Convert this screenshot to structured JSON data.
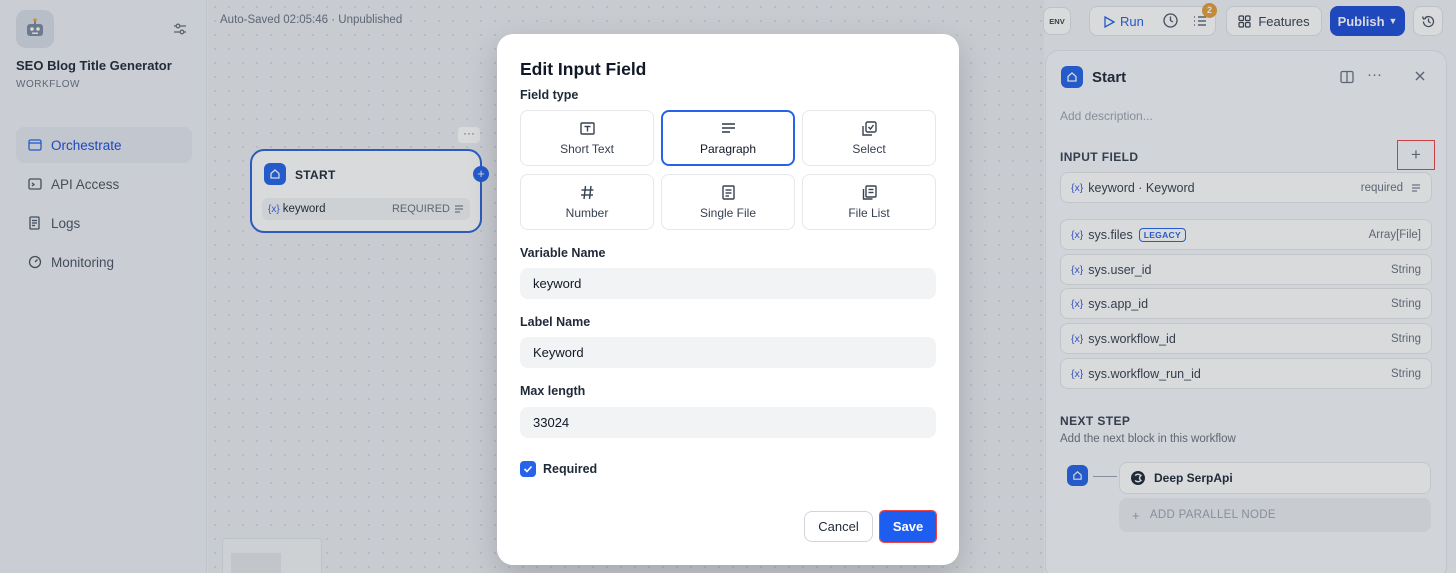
{
  "app": {
    "title": "SEO Blog Title Generator",
    "type_label": "WORKFLOW",
    "autosave": "Auto-Saved 02:05:46 · Unpublished"
  },
  "sidebar": {
    "items": [
      {
        "label": "Orchestrate",
        "icon": "terminal-window-icon",
        "active": true
      },
      {
        "label": "API Access",
        "icon": "terminal-icon",
        "active": false
      },
      {
        "label": "Logs",
        "icon": "file-list-icon",
        "active": false
      },
      {
        "label": "Monitoring",
        "icon": "gauge-icon",
        "active": false
      }
    ]
  },
  "canvas": {
    "start_node": {
      "title": "START",
      "var_prefix": "{x}",
      "var_name": "keyword",
      "required_label": "REQUIRED"
    },
    "dots": "···",
    "plus": "+"
  },
  "toolbar": {
    "env": "ENV",
    "run": "Run",
    "badge_count": "2",
    "features": "Features",
    "publish": "Publish"
  },
  "panel": {
    "title": "Start",
    "description_placeholder": "Add description...",
    "input_field_header": "INPUT FIELD",
    "add_symbol": "+",
    "input_fields": [
      {
        "prefix": "{x}",
        "name": "keyword · Keyword",
        "right": "required"
      }
    ],
    "sys_vars": [
      {
        "prefix": "{x}",
        "name": "sys.files",
        "badge": "LEGACY",
        "type": "Array[File]"
      },
      {
        "prefix": "{x}",
        "name": "sys.user_id",
        "type": "String"
      },
      {
        "prefix": "{x}",
        "name": "sys.app_id",
        "type": "String"
      },
      {
        "prefix": "{x}",
        "name": "sys.workflow_id",
        "type": "String"
      },
      {
        "prefix": "{x}",
        "name": "sys.workflow_run_id",
        "type": "String"
      }
    ],
    "next_step_header": "NEXT STEP",
    "next_step_desc": "Add the next block in this workflow",
    "next_block": "Deep SerpApi",
    "add_parallel": "ADD PARALLEL NODE"
  },
  "modal": {
    "title": "Edit Input Field",
    "field_type_label": "Field type",
    "field_types": [
      {
        "label": "Short Text",
        "icon": "text-box-icon",
        "selected": false
      },
      {
        "label": "Paragraph",
        "icon": "paragraph-icon",
        "selected": true
      },
      {
        "label": "Select",
        "icon": "checkbox-stack-icon",
        "selected": false
      },
      {
        "label": "Number",
        "icon": "hash-icon",
        "selected": false
      },
      {
        "label": "Single File",
        "icon": "file-icon",
        "selected": false
      },
      {
        "label": "File List",
        "icon": "files-icon",
        "selected": false
      }
    ],
    "variable_name_label": "Variable Name",
    "variable_name_value": "keyword",
    "label_name_label": "Label Name",
    "label_name_value": "Keyword",
    "max_length_label": "Max length",
    "max_length_value": "33024",
    "required_label": "Required",
    "required_checked": true,
    "cancel": "Cancel",
    "save": "Save"
  },
  "colors": {
    "accent": "#2563eb",
    "publish": "#1d4ed8",
    "badge": "#e59e3a",
    "highlight_outline": "#ef4444"
  }
}
